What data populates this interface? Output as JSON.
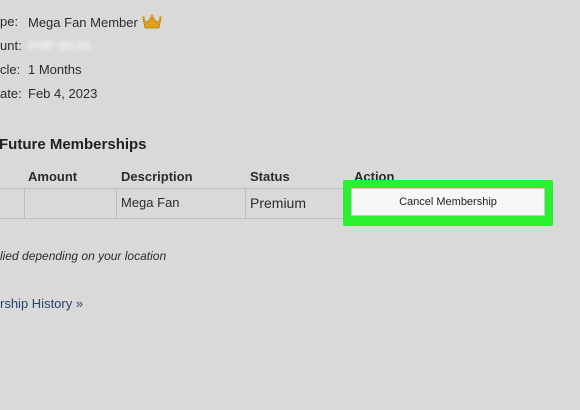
{
  "membership_info": {
    "type_label": "pe:",
    "type_value": "Mega Fan Member",
    "amount_label": "unt:",
    "amount_value": "PHP 00.00",
    "cycle_label": "cle:",
    "cycle_value": "1 Months",
    "date_label": "ate:",
    "date_value": "Feb 4, 2023"
  },
  "future_section": {
    "title": "Future Memberships"
  },
  "table": {
    "headers": {
      "amount": "Amount",
      "description": "Description",
      "status": "Status",
      "action": "Action"
    },
    "rows": [
      {
        "amount": "",
        "description": "Mega Fan",
        "status": "Premium",
        "action_label": "Cancel Membership"
      }
    ]
  },
  "note": "lied depending on your location",
  "history_link": "rship History »",
  "colors": {
    "highlight": "#2af02f",
    "crown": "#e0a21a",
    "background": "#d9d9d9",
    "link": "#2d3f6a"
  }
}
